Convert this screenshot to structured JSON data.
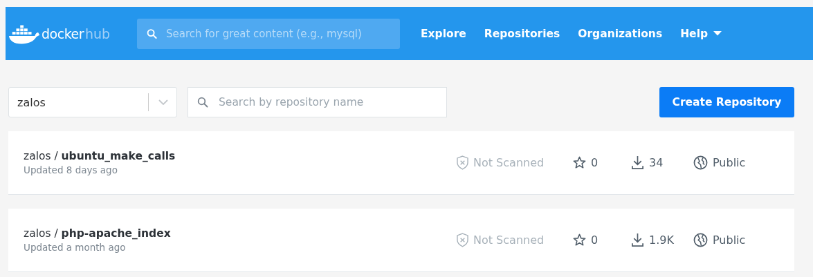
{
  "header": {
    "logo": {
      "word": "docker",
      "suffix": "hub"
    },
    "search": {
      "placeholder": "Search for great content (e.g., mysql)"
    },
    "nav": [
      {
        "label": "Explore",
        "kind": "link"
      },
      {
        "label": "Repositories",
        "kind": "link"
      },
      {
        "label": "Organizations",
        "kind": "link"
      },
      {
        "label": "Help",
        "kind": "menu"
      }
    ]
  },
  "filters": {
    "namespace": {
      "value": "zalos"
    },
    "search": {
      "placeholder": "Search by repository name"
    },
    "create_button": "Create Repository"
  },
  "repositories": [
    {
      "title": "zalos / **ubuntu_make_calls**",
      "updated": "Updated 8 days ago",
      "scan": "Not Scanned",
      "stars": "0",
      "downloads": "34",
      "visibility": "Public"
    },
    {
      "title": "zalos / **php-apache_index**",
      "updated": "Updated a month ago",
      "scan": "Not Scanned",
      "stars": "0",
      "downloads": "1.9K",
      "visibility": "Public"
    }
  ]
}
